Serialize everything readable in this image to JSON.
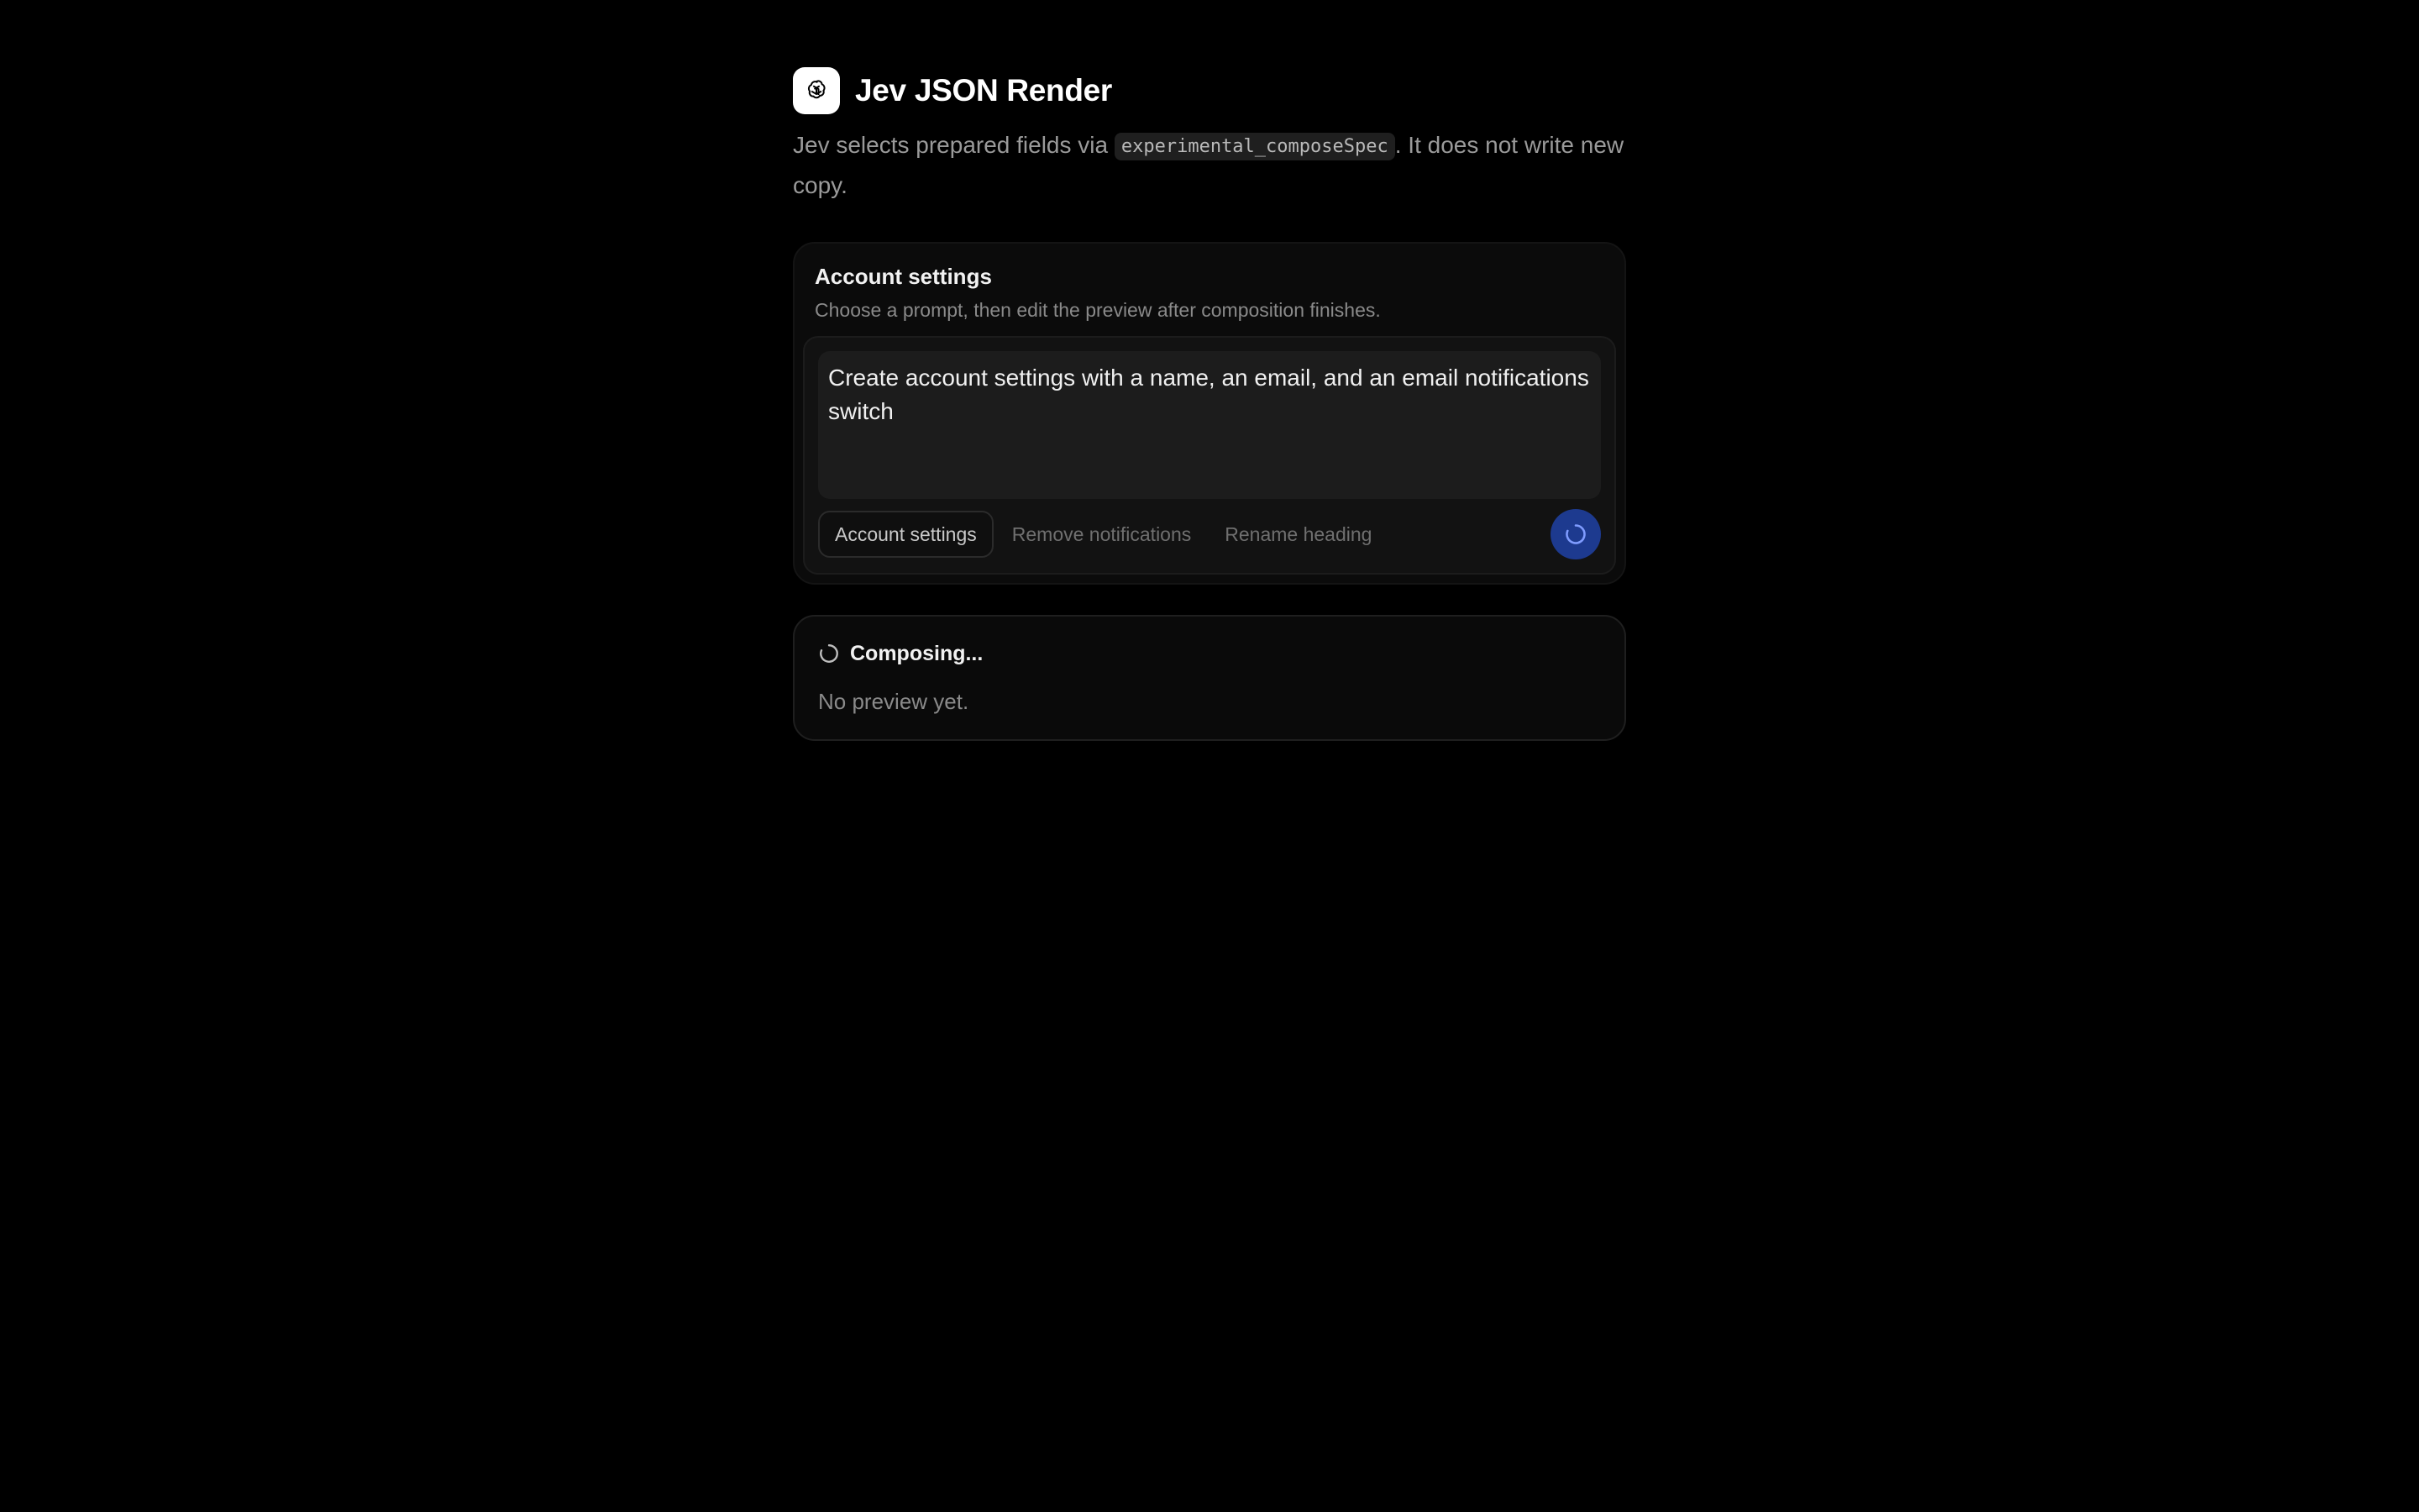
{
  "app": {
    "title": "Jev JSON Render",
    "logo_icon": "openai-knot-icon",
    "subtitle_prefix": "Jev selects prepared fields via ",
    "subtitle_code": "experimental_composeSpec",
    "subtitle_suffix": ". It does not write new copy."
  },
  "card": {
    "title": "Account settings",
    "description": "Choose a prompt, then edit the preview after composition finishes.",
    "prompt_value": "Create account settings with a name, an email, and an email notifications switch",
    "chips": [
      {
        "label": "Account settings",
        "selected": true
      },
      {
        "label": "Remove notifications",
        "selected": false
      },
      {
        "label": "Rename heading",
        "selected": false
      }
    ],
    "send_button_icon": "spinner-icon",
    "accent_color": "#1d3a8f"
  },
  "preview": {
    "status": "Composing...",
    "status_icon": "spinner-icon",
    "empty_message": "No preview yet."
  }
}
